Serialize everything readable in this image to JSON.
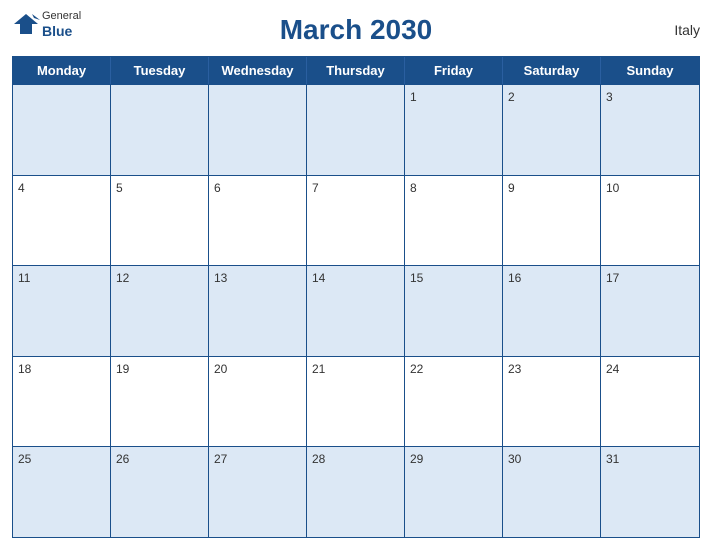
{
  "header": {
    "title": "March 2030",
    "country": "Italy",
    "logo": {
      "general": "General",
      "blue": "Blue"
    }
  },
  "days": {
    "headers": [
      "Monday",
      "Tuesday",
      "Wednesday",
      "Thursday",
      "Friday",
      "Saturday",
      "Sunday"
    ]
  },
  "weeks": [
    [
      {
        "date": "",
        "empty": true
      },
      {
        "date": "",
        "empty": true
      },
      {
        "date": "",
        "empty": true
      },
      {
        "date": "",
        "empty": true
      },
      {
        "date": "1"
      },
      {
        "date": "2"
      },
      {
        "date": "3"
      }
    ],
    [
      {
        "date": "4"
      },
      {
        "date": "5"
      },
      {
        "date": "6"
      },
      {
        "date": "7"
      },
      {
        "date": "8"
      },
      {
        "date": "9"
      },
      {
        "date": "10"
      }
    ],
    [
      {
        "date": "11"
      },
      {
        "date": "12"
      },
      {
        "date": "13"
      },
      {
        "date": "14"
      },
      {
        "date": "15"
      },
      {
        "date": "16"
      },
      {
        "date": "17"
      }
    ],
    [
      {
        "date": "18"
      },
      {
        "date": "19"
      },
      {
        "date": "20"
      },
      {
        "date": "21"
      },
      {
        "date": "22"
      },
      {
        "date": "23"
      },
      {
        "date": "24"
      }
    ],
    [
      {
        "date": "25"
      },
      {
        "date": "26"
      },
      {
        "date": "27"
      },
      {
        "date": "28"
      },
      {
        "date": "29"
      },
      {
        "date": "30"
      },
      {
        "date": "31"
      }
    ]
  ]
}
